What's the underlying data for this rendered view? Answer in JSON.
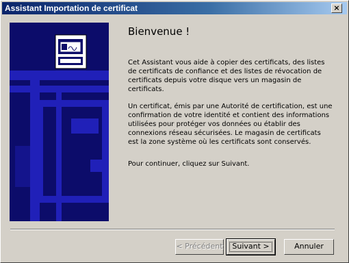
{
  "window": {
    "title": "Assistant Importation de certificat",
    "close_label": "×"
  },
  "content": {
    "heading": "Bienvenue !",
    "paragraphs": [
      "Cet Assistant vous aide à copier des certificats, des listes de certificats de confiance et des listes de révocation de certificats depuis votre disque vers un magasin de certificats.",
      "Un certificat, émis par une Autorité de certification, est une confirmation de votre identité et contient des informations utilisées pour protéger vos données ou établir des connexions réseau sécurisées. Le magasin de certificats est la zone système où les certificats sont conservés.",
      "Pour continuer, cliquez sur Suivant."
    ]
  },
  "buttons": {
    "back": "< Précédent",
    "next": "Suivant >",
    "cancel": "Annuler"
  },
  "colors": {
    "title_gradient_start": "#0a246a",
    "title_gradient_end": "#a6caf0",
    "banner": "#0c0c6a",
    "banner_accent": "#2020b8",
    "face": "#d4d0c8"
  }
}
